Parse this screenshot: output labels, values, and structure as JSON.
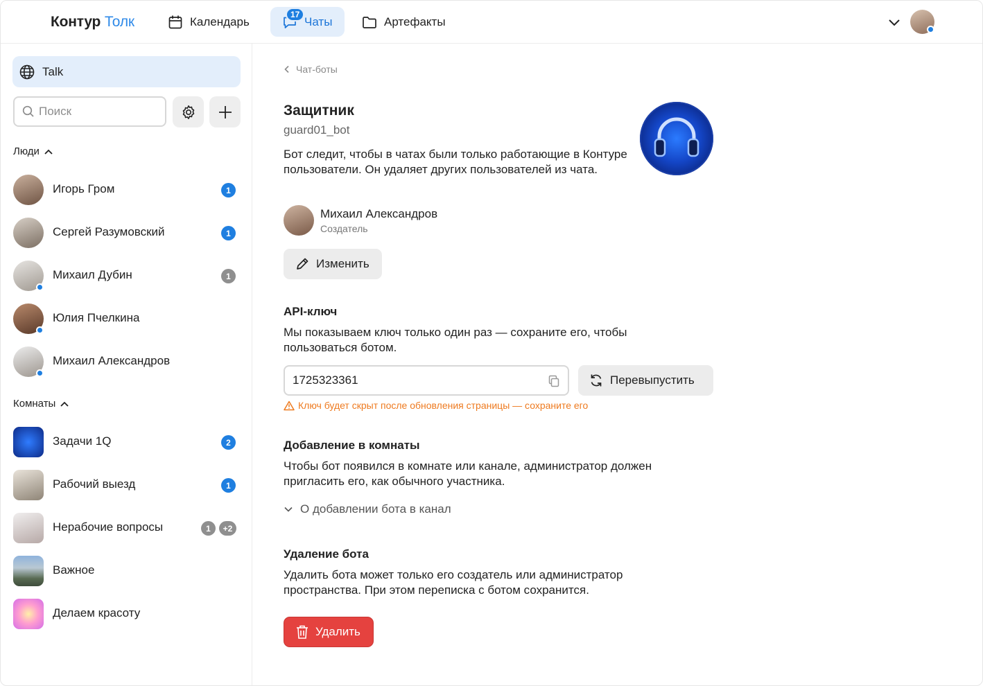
{
  "header": {
    "logo_part1": "Контур",
    "logo_part2": "Толк",
    "nav": [
      {
        "label": "Календарь",
        "icon": "calendar-icon"
      },
      {
        "label": "Чаты",
        "icon": "chat-icon",
        "badge": "17"
      },
      {
        "label": "Артефакты",
        "icon": "folder-icon"
      }
    ]
  },
  "sidebar": {
    "space_label": "Talk",
    "search_placeholder": "Поиск",
    "people_title": "Люди",
    "people": [
      {
        "name": "Игорь Гром",
        "count": "1",
        "count_color": "blue",
        "online": false
      },
      {
        "name": "Сергей Разумовский",
        "count": "1",
        "count_color": "blue",
        "online": false
      },
      {
        "name": "Михаил Дубин",
        "count": "1",
        "count_color": "grey",
        "online": true
      },
      {
        "name": "Юлия Пчелкина",
        "count": "",
        "count_color": "",
        "online": true
      },
      {
        "name": "Михаил Александров",
        "count": "",
        "count_color": "",
        "online": true
      }
    ],
    "rooms_title": "Комнаты",
    "rooms": [
      {
        "name": "Задачи 1Q",
        "count": "2",
        "count_color": "blue"
      },
      {
        "name": "Рабочий выезд",
        "count": "1",
        "count_color": "blue"
      },
      {
        "name": "Нерабочие вопросы",
        "count": "1",
        "count_color": "grey",
        "extra": "+2"
      },
      {
        "name": "Важное",
        "count": "",
        "count_color": ""
      },
      {
        "name": "Делаем красоту",
        "count": "",
        "count_color": ""
      }
    ]
  },
  "main": {
    "breadcrumb": "Чат-боты",
    "bot": {
      "title": "Защитник",
      "handle": "guard01_bot",
      "description": "Бот следит, чтобы в чатах были только работающие в Контуре пользователи. Он удаляет других пользователей из чата."
    },
    "creator": {
      "name": "Михаил Александров",
      "role": "Создатель"
    },
    "edit_label": "Изменить",
    "api": {
      "title": "API-ключ",
      "text": "Мы показываем ключ только один раз — сохраните его, чтобы пользоваться ботом.",
      "key_value": "1725323361",
      "reissue_label": "Перевыпустить",
      "warning": "Ключ будет скрыт после обновления страницы — сохраните его"
    },
    "rooms_add": {
      "title": "Добавление в комнаты",
      "text": "Чтобы бот появился в комнате или канале, администратор должен пригласить его, как обычного участника.",
      "expander": "О добавлении бота в канал"
    },
    "delete": {
      "title": "Удаление бота",
      "text": "Удалить бота может только его создатель или администратор пространства. При этом переписка с ботом сохранится.",
      "button": "Удалить"
    }
  },
  "colors": {
    "accent": "#1f7fe0",
    "active_bg": "#e3eefb",
    "danger": "#e5423f",
    "warning": "#ee7a1f"
  }
}
